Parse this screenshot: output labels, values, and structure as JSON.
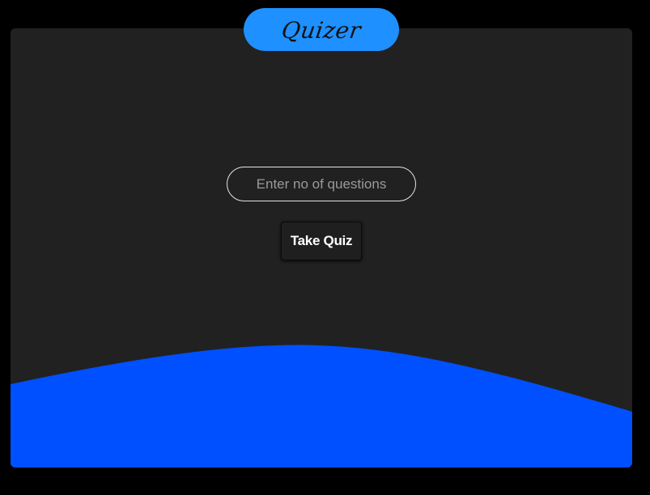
{
  "app": {
    "title": "Quizer"
  },
  "form": {
    "questions_placeholder": "Enter no of questions",
    "questions_value": "",
    "take_quiz_label": "Take Quiz"
  },
  "colors": {
    "page_background": "#000000",
    "card_background": "#212121",
    "brand_pill": "#1e90ff",
    "wave": "#0050ff",
    "button_text": "#ffffff"
  }
}
